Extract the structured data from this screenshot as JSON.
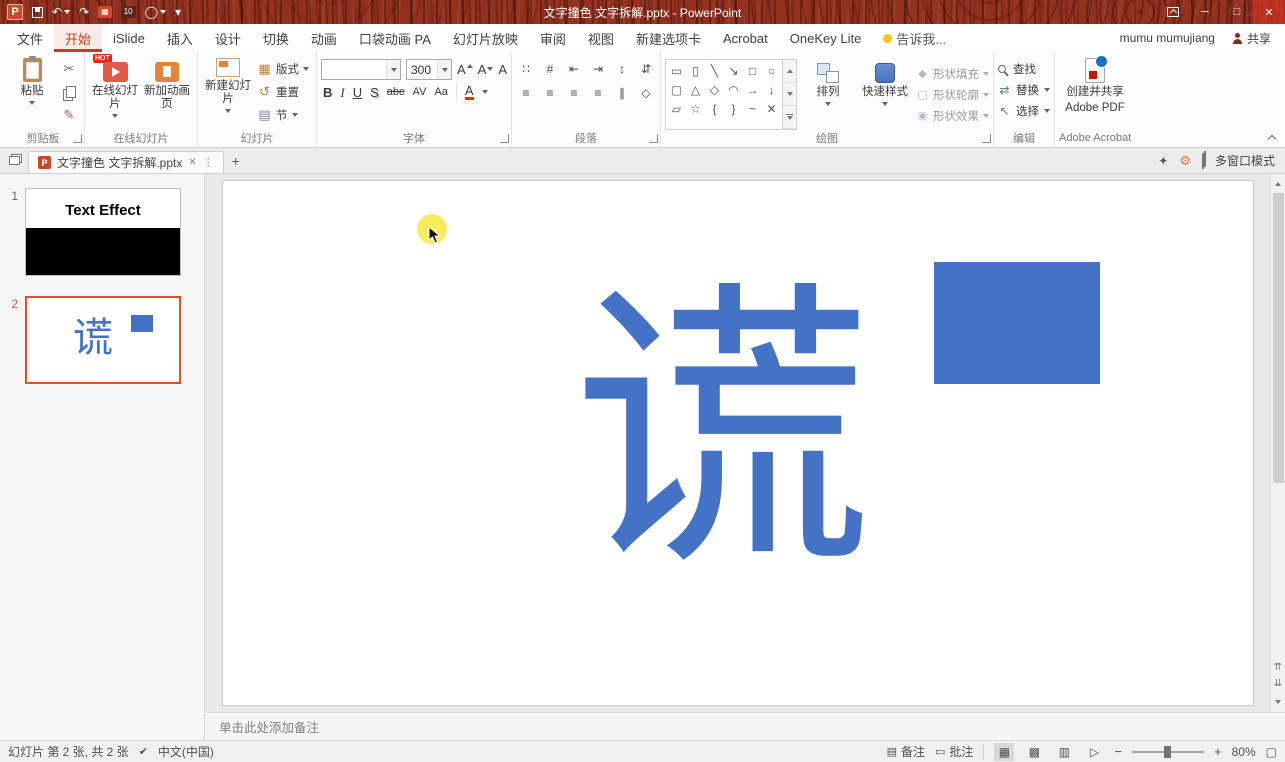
{
  "titlebar": {
    "title": "文字撞色 文字拆解.pptx - PowerPoint",
    "qat": {
      "logo": "P",
      "undo": "↶",
      "redo": "↷",
      "addin_grid": "▦",
      "addin_ten": "10",
      "addin_circle": "◯",
      "more": "▾"
    },
    "controls": {
      "minimize": "─",
      "maximize": "□",
      "close": "✕"
    }
  },
  "ribbon": {
    "tabs": [
      {
        "label": "文件",
        "type": "file"
      },
      {
        "label": "开始",
        "active": true
      },
      {
        "label": "iSlide"
      },
      {
        "label": "插入"
      },
      {
        "label": "设计"
      },
      {
        "label": "切换"
      },
      {
        "label": "动画"
      },
      {
        "label": "口袋动画 PA"
      },
      {
        "label": "幻灯片放映"
      },
      {
        "label": "审阅"
      },
      {
        "label": "视图"
      },
      {
        "label": "新建选项卡"
      },
      {
        "label": "Acrobat"
      },
      {
        "label": "OneKey Lite"
      },
      {
        "label": "告诉我...",
        "type": "tellme"
      }
    ],
    "account": "mumu mumujiang",
    "share": "共享"
  },
  "groups": {
    "clipboard": {
      "label": "剪贴板",
      "paste": "粘贴",
      "cut": "✂",
      "painter": "✎"
    },
    "online": {
      "label": "在线幻灯片",
      "online_slides": "在线幻灯片",
      "new_anim": "新加动画页",
      "hot": "HOT"
    },
    "slides": {
      "label": "幻灯片",
      "new_slide": "新建幻灯片",
      "layout": "版式",
      "reset": "重置",
      "section": "节",
      "layout_icon": "▦",
      "reset_icon": "↺",
      "section_icon": "▤"
    },
    "font": {
      "label": "字体",
      "name": "",
      "size": "300",
      "grow": "A",
      "shrink": "A",
      "clear": "A",
      "bold": "B",
      "italic": "I",
      "underline": "U",
      "shadow": "S",
      "strike": "abc",
      "spacing": "AV",
      "case": "Aa",
      "color": "A"
    },
    "paragraph": {
      "label": "段落",
      "row1": [
        "∷",
        "#",
        "⇤",
        "⇥",
        "↕",
        "⇵"
      ],
      "row2": [
        "≡",
        "≡",
        "≡",
        "≡",
        "∥",
        "◇"
      ]
    },
    "drawing": {
      "label": "绘图",
      "gallery": [
        "▭",
        "▯",
        "╲",
        "↘",
        "□",
        "○",
        "▢",
        "△",
        "◇",
        "◠",
        "→",
        "↓",
        "▱",
        "☆",
        "{",
        "}",
        "~",
        "✕"
      ],
      "arrange": "排列",
      "quick_styles": "快速样式",
      "fill": "形状填充",
      "fill_icon": "◆",
      "outline": "形状轮廓",
      "outline_icon": "▢",
      "effects": "形状效果",
      "effects_icon": "◉"
    },
    "editing": {
      "label": "编辑",
      "find": "查找",
      "replace": "替换",
      "replace_icon": "⇄",
      "select": "选择",
      "select_icon": "↖"
    },
    "acrobat": {
      "label": "Adobe Acrobat",
      "line1": "创建并共享",
      "line2": "Adobe PDF"
    }
  },
  "doctabs": {
    "file_icon": "P",
    "tab": "文字撞色 文字拆解.pptx",
    "close": "✕",
    "menu": "⋮",
    "add": "+",
    "plugin1": "✦",
    "plugin_gear": "⚙",
    "mode": "多窗口模式"
  },
  "panel": {
    "slides": [
      {
        "num": "1",
        "text": "Text Effect"
      },
      {
        "num": "2",
        "char": "谎"
      }
    ]
  },
  "slide": {
    "char": "谎",
    "char_color": "#4472C4",
    "rect_color": "#4472C4"
  },
  "notes": {
    "placeholder": "单击此处添加备注"
  },
  "statusbar": {
    "slide_info": "幻灯片 第 2 张, 共 2 张",
    "spell": "✔",
    "language": "中文(中国)",
    "notes_icon": "▤",
    "notes_label": "备注",
    "comments_icon": "▭",
    "comments_label": "批注",
    "views": {
      "normal": "▦",
      "sorter": "▩",
      "reading": "▥",
      "slideshow": "▷"
    },
    "zoom_out": "−",
    "zoom_in": "+",
    "zoom": "80%",
    "fit": "▢"
  },
  "colors": {
    "theme": "#93301E",
    "accent_blue": "#4472C4",
    "selection_orange": "#DF5327"
  }
}
